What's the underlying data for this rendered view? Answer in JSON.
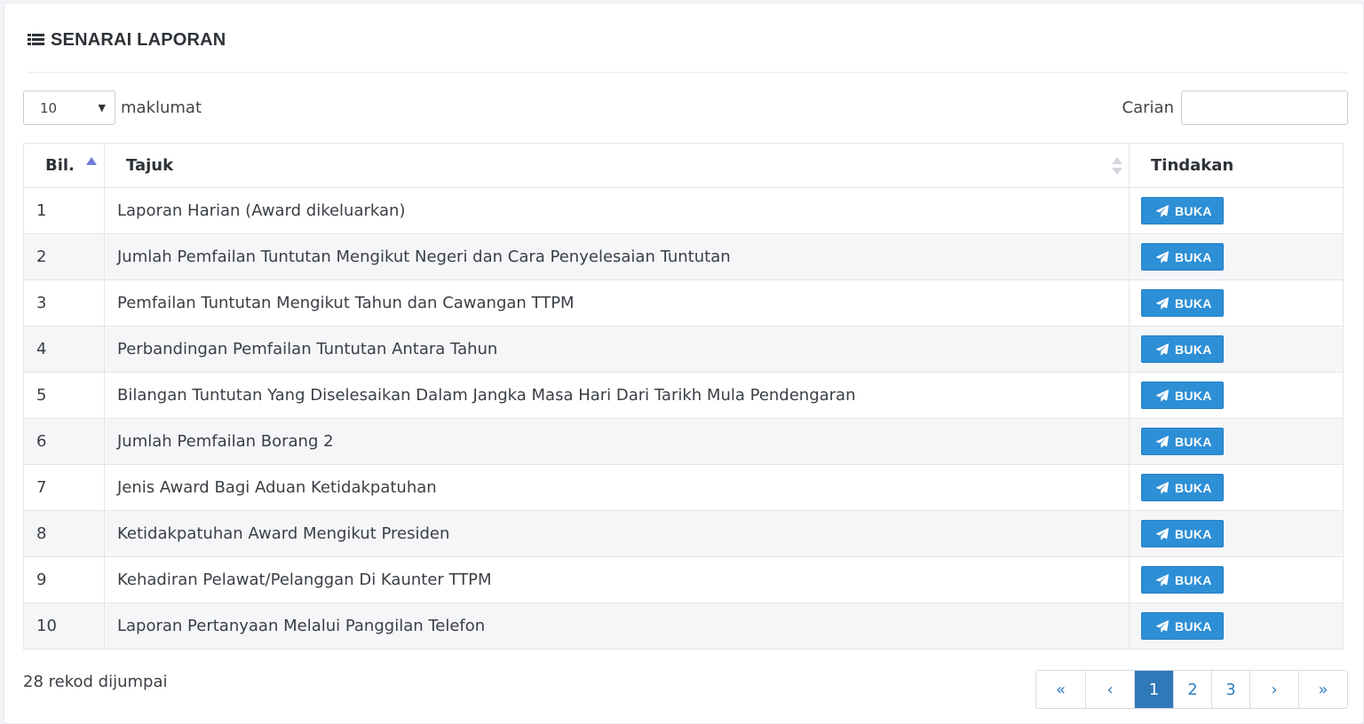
{
  "header": {
    "title": "SENARAI LAPORAN",
    "icon": "list-icon"
  },
  "length_menu": {
    "selected": "10",
    "label": "maklumat"
  },
  "search": {
    "label": "Carian",
    "value": ""
  },
  "table": {
    "columns": [
      "Bil.",
      "Tajuk",
      "Tindakan"
    ],
    "action_label": "BUKA",
    "rows": [
      {
        "no": "1",
        "title": "Laporan Harian (Award dikeluarkan)"
      },
      {
        "no": "2",
        "title": "Jumlah Pemfailan Tuntutan Mengikut Negeri dan Cara Penyelesaian Tuntutan"
      },
      {
        "no": "3",
        "title": "Pemfailan Tuntutan Mengikut Tahun dan Cawangan TTPM"
      },
      {
        "no": "4",
        "title": "Perbandingan Pemfailan Tuntutan Antara Tahun"
      },
      {
        "no": "5",
        "title": "Bilangan Tuntutan Yang Diselesaikan Dalam Jangka Masa Hari Dari Tarikh Mula Pendengaran"
      },
      {
        "no": "6",
        "title": "Jumlah Pemfailan Borang 2"
      },
      {
        "no": "7",
        "title": "Jenis Award Bagi Aduan Ketidakpatuhan"
      },
      {
        "no": "8",
        "title": "Ketidakpatuhan Award Mengikut Presiden"
      },
      {
        "no": "9",
        "title": "Kehadiran Pelawat/Pelanggan Di Kaunter TTPM"
      },
      {
        "no": "10",
        "title": "Laporan Pertanyaan Melalui Panggilan Telefon"
      }
    ]
  },
  "footer": {
    "info": "28 rekod dijumpai",
    "pages": [
      "«",
      "‹",
      "1",
      "2",
      "3",
      "›",
      "»"
    ],
    "active_page": "1"
  },
  "colors": {
    "button": "#2d8fd6",
    "active_page": "#3079b8",
    "link": "#2f7fc1"
  }
}
